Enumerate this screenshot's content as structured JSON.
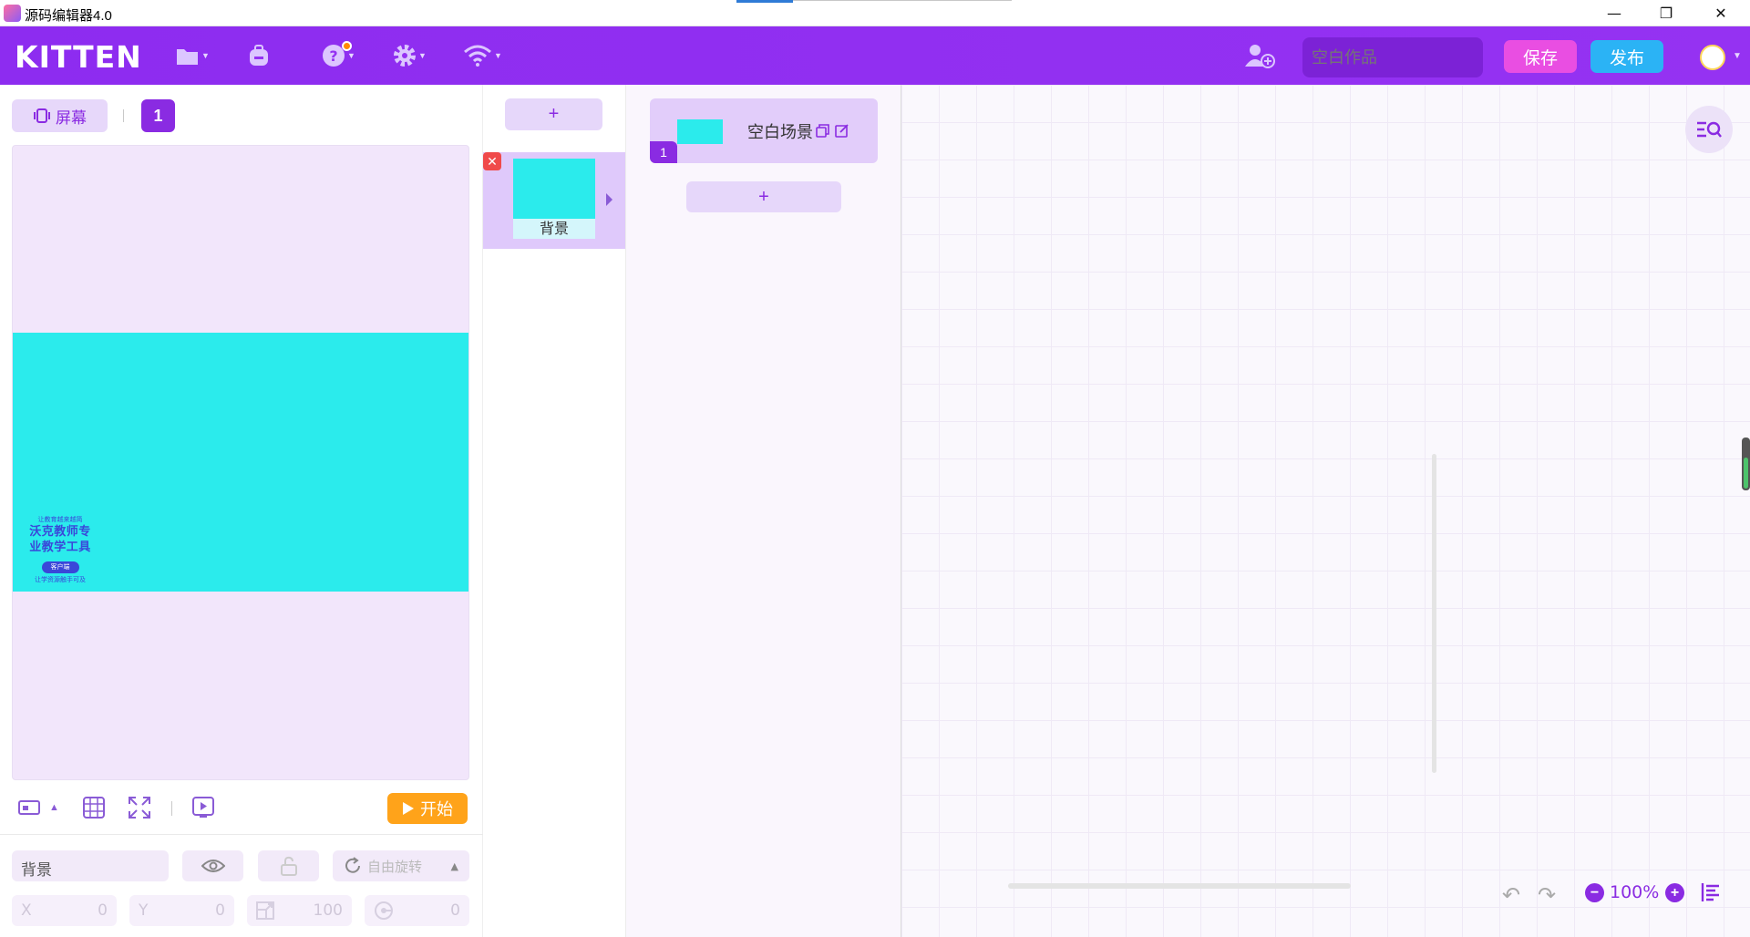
{
  "window": {
    "title": "源码编辑器4.0",
    "controls": {
      "minimize": "—",
      "restore": "❐",
      "close": "✕"
    }
  },
  "header": {
    "logo": "KITTEN",
    "icons": [
      "folder-icon",
      "backpack-icon",
      "help-icon",
      "settings-icon",
      "wifi-icon"
    ],
    "add_user_icon": "add-user-icon",
    "project_name_placeholder": "空白作品",
    "save_label": "保存",
    "publish_label": "发布",
    "colors": {
      "bar": "#8d2cf0",
      "save": "#e94ee2",
      "publish": "#2bb3f5"
    }
  },
  "stage": {
    "screen_label": "屏幕",
    "page_number": "1",
    "watermark": {
      "top": "让教育越来越简",
      "line1": "沃克教师专",
      "line2": "业教学工具",
      "badge": "客户端",
      "bottom": "让学资源触手可及"
    },
    "start_label": "开始",
    "canvas_color": "#2bebec"
  },
  "properties": {
    "name_value": "背景",
    "rotation_label": "自由旋转",
    "x_label": "X",
    "x_value": "0",
    "y_label": "Y",
    "y_value": "0",
    "scale_value": "100",
    "rotation_value": "0"
  },
  "sprites": {
    "add_label": "+",
    "items": [
      {
        "label": "背景",
        "delete": "✕"
      }
    ]
  },
  "scenes": {
    "items": [
      {
        "name": "空白场景",
        "number": "1"
      }
    ],
    "add_label": "+"
  },
  "workspace": {
    "zoom_label": "100%",
    "zoom_minus": "−",
    "zoom_plus": "+",
    "undo": "↶",
    "redo": "↷"
  }
}
